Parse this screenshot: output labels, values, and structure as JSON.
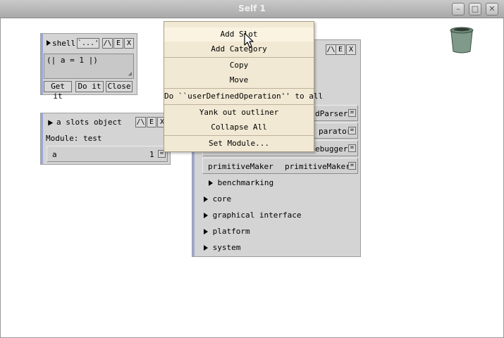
{
  "window": {
    "title": "Self 1",
    "buttons": {
      "minimize": "–",
      "maximize": "□",
      "close": "✕"
    }
  },
  "shell": {
    "title": "shell",
    "header_buttons": [
      "`...'",
      "/\\",
      "E",
      "X"
    ],
    "code": "(| a = 1 |)",
    "buttons": [
      "Get it",
      "Do it",
      "Close"
    ]
  },
  "slots_object": {
    "title": "a slots object",
    "header_buttons": [
      "/\\",
      "E",
      "X"
    ],
    "module_label": "Module: test",
    "slot": {
      "name": "a",
      "value": "1",
      "eq": "="
    }
  },
  "lobby": {
    "header_buttons": [
      "/\\",
      "E",
      "X"
    ],
    "slots": [
      {
        "value": "dParser",
        "eq": "="
      },
      {
        "value": "parator",
        "eq": "="
      },
      {
        "value": "ebugger",
        "eq": "="
      },
      {
        "name": "primitiveMaker",
        "value": "primitiveMaker",
        "eq": "="
      }
    ],
    "categories": [
      "benchmarking",
      "core",
      "graphical interface",
      "platform",
      "system"
    ]
  },
  "menu": {
    "items": [
      {
        "label": "Add Slot",
        "highlighted": true
      },
      {
        "label": "Add Category"
      },
      {
        "label": "Copy"
      },
      {
        "label": "Move"
      },
      {
        "label": "Do ``userDefinedOperation'' to all"
      },
      {
        "label": "Yank out outliner"
      },
      {
        "label": "Collapse All"
      },
      {
        "label": "Set Module..."
      }
    ]
  },
  "icons": {
    "trash": "trash-can-icon",
    "cursor": "mouse-pointer-icon"
  },
  "colors": {
    "desktop": "#ffffff",
    "outliner_bg": "#d4d4d4",
    "outliner_accent": "#9da6d8",
    "menu_bg": "#f2e9d4",
    "menu_highlight": "#faf3e1",
    "trash": "#7f9a8a"
  }
}
